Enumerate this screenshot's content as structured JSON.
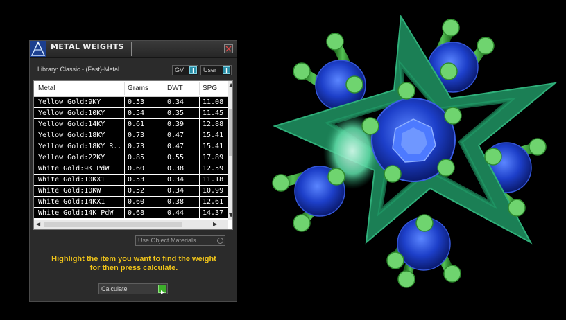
{
  "window": {
    "title": "METAL WEIGHTS"
  },
  "library": {
    "label": "Library: Classic - (Fast)-Metal",
    "gv_select": "GV",
    "user_select": "User"
  },
  "table": {
    "columns": [
      "Metal",
      "Grams",
      "DWT",
      "SPG"
    ],
    "rows": [
      [
        "Yellow Gold:9KY",
        "0.53",
        "0.34",
        "11.08"
      ],
      [
        "Yellow Gold:10KY",
        "0.54",
        "0.35",
        "11.45"
      ],
      [
        "Yellow Gold:14KY",
        "0.61",
        "0.39",
        "12.88"
      ],
      [
        "Yellow Gold:18KY",
        "0.73",
        "0.47",
        "15.41"
      ],
      [
        "Yellow Gold:18KY R...",
        "0.73",
        "0.47",
        "15.41"
      ],
      [
        "Yellow Gold:22KY",
        "0.85",
        "0.55",
        "17.89"
      ],
      [
        "White Gold:9K PdW",
        "0.60",
        "0.38",
        "12.59"
      ],
      [
        "White Gold:10KX1",
        "0.53",
        "0.34",
        "11.18"
      ],
      [
        "White Gold:10KW",
        "0.52",
        "0.34",
        "10.99"
      ],
      [
        "White Gold:14KX1",
        "0.60",
        "0.38",
        "12.61"
      ],
      [
        "White Gold:14K PdW",
        "0.68",
        "0.44",
        "14.37"
      ]
    ]
  },
  "options": {
    "use_object_materials": "Use Object Materials"
  },
  "hint": {
    "line1": "Highlight the item you want to find the weight",
    "line2": "for then press calculate."
  },
  "actions": {
    "calculate": "Calculate"
  },
  "colors": {
    "panel_bg": "#2b2b2b",
    "hint_text": "#f0c419",
    "accent_blue": "#2a8fa8",
    "accent_green": "#3dae2b",
    "star": "#1e8a5c",
    "gem": "#1f3fc4",
    "prong": "#48c048"
  },
  "icons": {
    "logo": "app-logo-icon",
    "close": "close-icon",
    "dropdown": "chevron-down-icon",
    "play": "play-icon"
  }
}
